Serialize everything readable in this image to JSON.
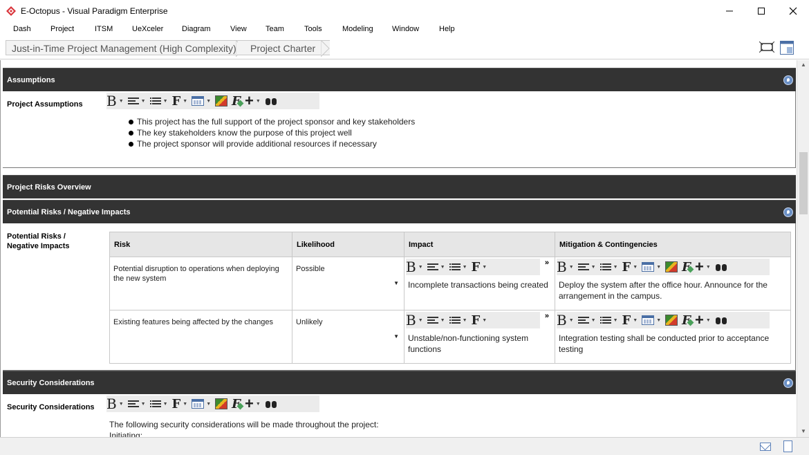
{
  "window": {
    "title": "E-Octopus - Visual Paradigm Enterprise",
    "minimize": "–",
    "maximize": "☐",
    "close": "✕"
  },
  "menu": [
    "Dash",
    "Project",
    "ITSM",
    "UeXceler",
    "Diagram",
    "View",
    "Team",
    "Tools",
    "Modeling",
    "Window",
    "Help"
  ],
  "breadcrumb": [
    "Just-in-Time Project Management (High Complexity)",
    "Project Charter"
  ],
  "sections": {
    "assumptions": {
      "header": "Assumptions",
      "field_label": "Project Assumptions",
      "bullets": [
        "This project has the full support of the project sponsor and key stakeholders",
        "The key stakeholders know the purpose of this project well",
        "The project sponsor will provide additional resources if necessary"
      ]
    },
    "risks_overview": {
      "header": "Project Risks Overview"
    },
    "potential_risks": {
      "header": "Potential Risks / Negative Impacts",
      "field_label_1": "Potential Risks /",
      "field_label_2": "Negative Impacts",
      "columns": [
        "Risk",
        "Likelihood",
        "Impact",
        "Mitigation & Contingencies"
      ],
      "rows": [
        {
          "risk": "Potential disruption to operations when deploying the new system",
          "likelihood": "Possible",
          "impact": "Incomplete transactions being created",
          "mitigation": "Deploy the system after the office hour. Announce for the arrangement in the campus."
        },
        {
          "risk": "Existing features being affected by the changes",
          "likelihood": "Unlikely",
          "impact": "Unstable/non-functioning system functions",
          "mitigation": "Integration testing shall be conducted prior to acceptance testing"
        }
      ]
    },
    "security": {
      "header": "Security Considerations",
      "field_label": "Security Considerations",
      "line1": "The following security considerations will be made throughout the project:",
      "line2": "Initiating:"
    }
  },
  "toolbar": {
    "bold": "B",
    "font": "F",
    "caret": "▼",
    "plus": "+",
    "more": "»",
    "formula": "F"
  },
  "icons": {
    "app": "octopus-logo-icon",
    "pin": "pin-icon",
    "fit": "fit-screen-icon",
    "panel": "panel-icon",
    "mail": "mail-icon",
    "note": "note-icon"
  },
  "colors": {
    "section_header_bg": "#333333",
    "pin_blue": "#6a8fc4",
    "app_logo_red": "#d9343b"
  }
}
